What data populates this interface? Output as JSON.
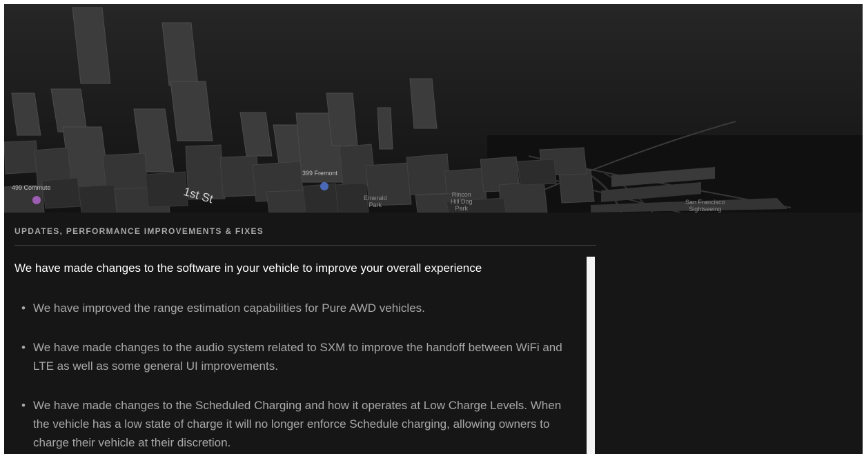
{
  "map": {
    "labels": {
      "commute": "499 Commute",
      "fremont": "399 Fremont",
      "street": "1st St",
      "emerald": "Emerald\nPark",
      "rincon": "Rincon\nHill Dog\nPark",
      "sightseeing": "San Francisco\nSightseeing"
    },
    "icons": {
      "commute_pin": "location-pin-icon",
      "fremont_pin": "location-pin-icon"
    },
    "colors": {
      "commute_pin": "#9d5db2",
      "fremont_pin": "#4a6ab8"
    }
  },
  "release_notes": {
    "section_heading": "UPDATES, PERFORMANCE IMPROVEMENTS & FIXES",
    "intro": "We have made changes to the software in your vehicle to improve your overall experience",
    "bullets": [
      {
        "text": "We have improved the range estimation capabilities for Pure AWD vehicles."
      },
      {
        "text": "We have made changes to the audio system related to SXM to improve the handoff between WiFi and LTE as well as some general UI improvements."
      },
      {
        "text": "We have made changes to the Scheduled Charging and how it operates at Low Charge Levels. When the vehicle has a low state of charge it will no longer enforce Schedule charging, allowing owners to charge their vehicle at their discretion."
      }
    ]
  },
  "ui": {
    "bullet_symbol": "•"
  }
}
